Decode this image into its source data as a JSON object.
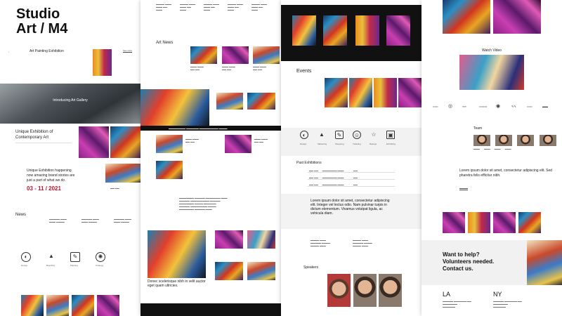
{
  "col1": {
    "title_line1": "Studio",
    "title_line2": "Art / M4",
    "exhibition_label": "Art Painting Exhibition",
    "exhibition_link": "See more",
    "intro_title": "Introducing Art Gallery",
    "unique_line1": "Unique Exhibition of",
    "unique_line2": "Contemporary Art",
    "happening_line1": "Unique Exhibition happening",
    "happening_line2": "now amazing brand stories are",
    "happening_line3": "just a part of what we do.",
    "date_range": "03 - 11 / 2021",
    "news_title": "News",
    "icon_labels": [
      "Design",
      "Branding",
      "Painting",
      "Strategy"
    ]
  },
  "col2": {
    "art_news_title": "Art News",
    "quote": "Donec scelerisque nibh in velit auctor eget quam ultricies."
  },
  "col3": {
    "events_title": "Events",
    "past_title": "Past Exhibitions",
    "lorem": "Lorem ipsum dolor sit amet, consectetur adipiscing elit. Integer vel lectus odio. Nam pulvinar turpis in dictum elementum. Vivamus volutpat ligula, ac vehicula diam.",
    "speakers_title": "Speakers",
    "icon_labels": [
      "Design",
      "Marketing",
      "Shopping",
      "Ticketing",
      "Ratings",
      "Exhibiting"
    ]
  },
  "col4": {
    "watch_title": "Watch Video",
    "team_title": "Team",
    "team_text": "Lorem ipsum dolor sit amet, consectetur adipiscing elit. Sed pharetra felis efficitur nibh.",
    "help_line1": "Want to help?",
    "help_line2": "Volunteers needed.",
    "help_line3": "Contact us.",
    "city1": "LA",
    "city2": "NY"
  }
}
